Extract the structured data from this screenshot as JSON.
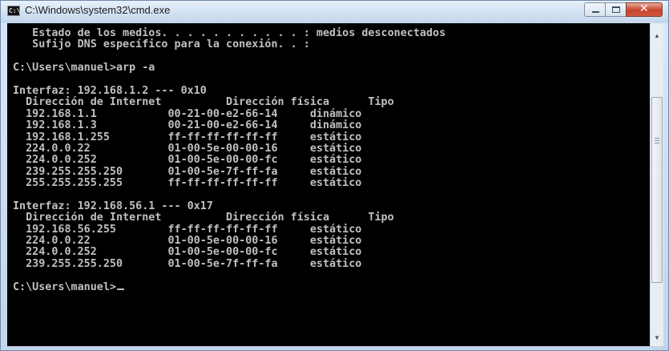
{
  "window": {
    "title": "C:\\Windows\\system32\\cmd.exe",
    "icon": "cmd-icon",
    "controls": {
      "minimize": "minimize-icon",
      "maximize": "maximize-icon",
      "close": "✕"
    },
    "close_color": "#c7432e"
  },
  "console": {
    "lines": [
      "   Estado de los medios. . . . . . . . . . . : medios desconectados",
      "   Sufijo DNS específico para la conexión. . :",
      "",
      "C:\\Users\\manuel>arp -a",
      "",
      "Interfaz: 192.168.1.2 --- 0x10",
      "  Dirección de Internet          Dirección física      Tipo",
      "  192.168.1.1           00-21-00-e2-66-14     dinámico",
      "  192.168.1.3           00-21-00-e2-66-14     dinámico",
      "  192.168.1.255         ff-ff-ff-ff-ff-ff     estático",
      "  224.0.0.22            01-00-5e-00-00-16     estático",
      "  224.0.0.252           01-00-5e-00-00-fc     estático",
      "  239.255.255.250       01-00-5e-7f-ff-fa     estático",
      "  255.255.255.255       ff-ff-ff-ff-ff-ff     estático",
      "",
      "Interfaz: 192.168.56.1 --- 0x17",
      "  Dirección de Internet          Dirección física      Tipo",
      "  192.168.56.255        ff-ff-ff-ff-ff-ff     estático",
      "  224.0.0.22            01-00-5e-00-00-16     estático",
      "  224.0.0.252           01-00-5e-00-00-fc     estático",
      "  239.255.255.250       01-00-5e-7f-ff-fa     estático",
      "",
      "C:\\Users\\manuel>"
    ],
    "text_color": "#c0c0c0",
    "background": "#000000"
  },
  "scrollbar": {
    "up": "▲",
    "down": "▼"
  }
}
